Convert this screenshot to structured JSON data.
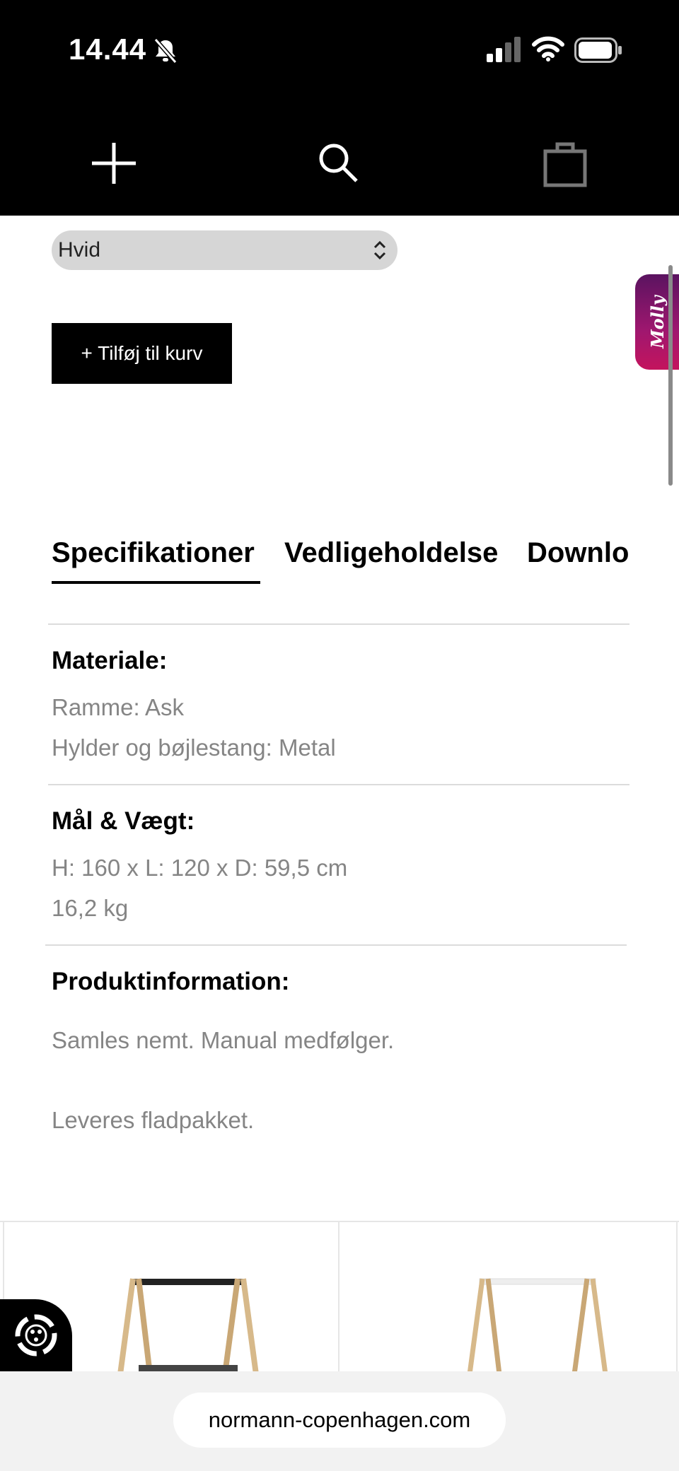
{
  "status_bar": {
    "time": "14.44",
    "icons": [
      "bell-slash-icon",
      "signal-icon",
      "wifi-icon",
      "battery-icon"
    ]
  },
  "header": {
    "icons": [
      "menu-icon",
      "search-icon",
      "bag-icon"
    ]
  },
  "product": {
    "variant_selected": "Hvid",
    "add_to_cart_label": "+ Tilføj til kurv"
  },
  "chat_widget": {
    "label": "Molly"
  },
  "tabs": [
    {
      "label": "Specifikationer",
      "active": true
    },
    {
      "label": "Vedligeholdelse",
      "active": false
    },
    {
      "label": "Downloads",
      "active": false
    }
  ],
  "specs": {
    "material": {
      "title": "Materiale:",
      "lines": [
        "Ramme: Ask",
        "Hylder og bøjlestang: Metal"
      ]
    },
    "dimensions": {
      "title": "Mål & Vægt:",
      "lines": [
        "H: 160 x L: 120 x D: 59,5 cm",
        "16,2 kg"
      ]
    },
    "info": {
      "title": "Produktinformation:",
      "lines": [
        "Samles nemt. Manual medfølger.",
        "Leveres fladpakket."
      ]
    }
  },
  "related_products": [
    {
      "image": "clothes-rack-black-icon"
    },
    {
      "image": "clothes-rack-white-icon"
    }
  ],
  "browser": {
    "url": "normann-copenhagen.com"
  },
  "colors": {
    "topbar": "#000000",
    "select_bg": "#d6d6d6",
    "muted_text": "#858585",
    "chat_gradient_start": "#5a1360",
    "chat_gradient_end": "#c4145d"
  }
}
